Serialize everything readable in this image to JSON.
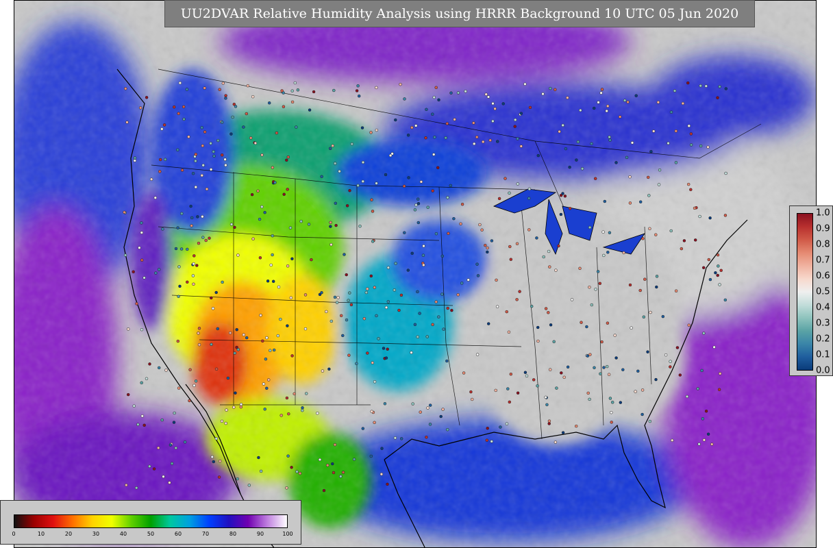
{
  "title": "UU2DVAR Relative Humidity Analysis using HRRR Background 10 UTC 05 Jun 2020",
  "map": {
    "land_color": "#c8c8c8",
    "ocean_color": "#1a3fd0",
    "border_color": "#000000"
  },
  "rh_colorbar": {
    "min": 0,
    "max": 100,
    "ticks": [
      "0",
      "10",
      "20",
      "30",
      "40",
      "50",
      "60",
      "70",
      "80",
      "90",
      "100"
    ],
    "colors": [
      "#111111",
      "#9a0000",
      "#e01010",
      "#ff7000",
      "#ffd200",
      "#f0ff00",
      "#60d000",
      "#00a000",
      "#00c8a0",
      "#00a0e0",
      "#0040ff",
      "#2010c0",
      "#7000b0",
      "#c080e0",
      "#ffffff"
    ]
  },
  "error_colorbar": {
    "min": 0.0,
    "max": 1.0,
    "ticks": [
      "1.0",
      "0.9",
      "0.8",
      "0.7",
      "0.6",
      "0.5",
      "0.4",
      "0.3",
      "0.2",
      "0.1",
      "0.0"
    ],
    "colors": [
      "#0a3b7a",
      "#1f5e9e",
      "#3a85a8",
      "#5aa3a5",
      "#8ec3bd",
      "#c2ddda",
      "#efefef",
      "#f7d8cc",
      "#f0b2a0",
      "#e58a72",
      "#d05a48",
      "#b8302e",
      "#8a1020"
    ]
  }
}
